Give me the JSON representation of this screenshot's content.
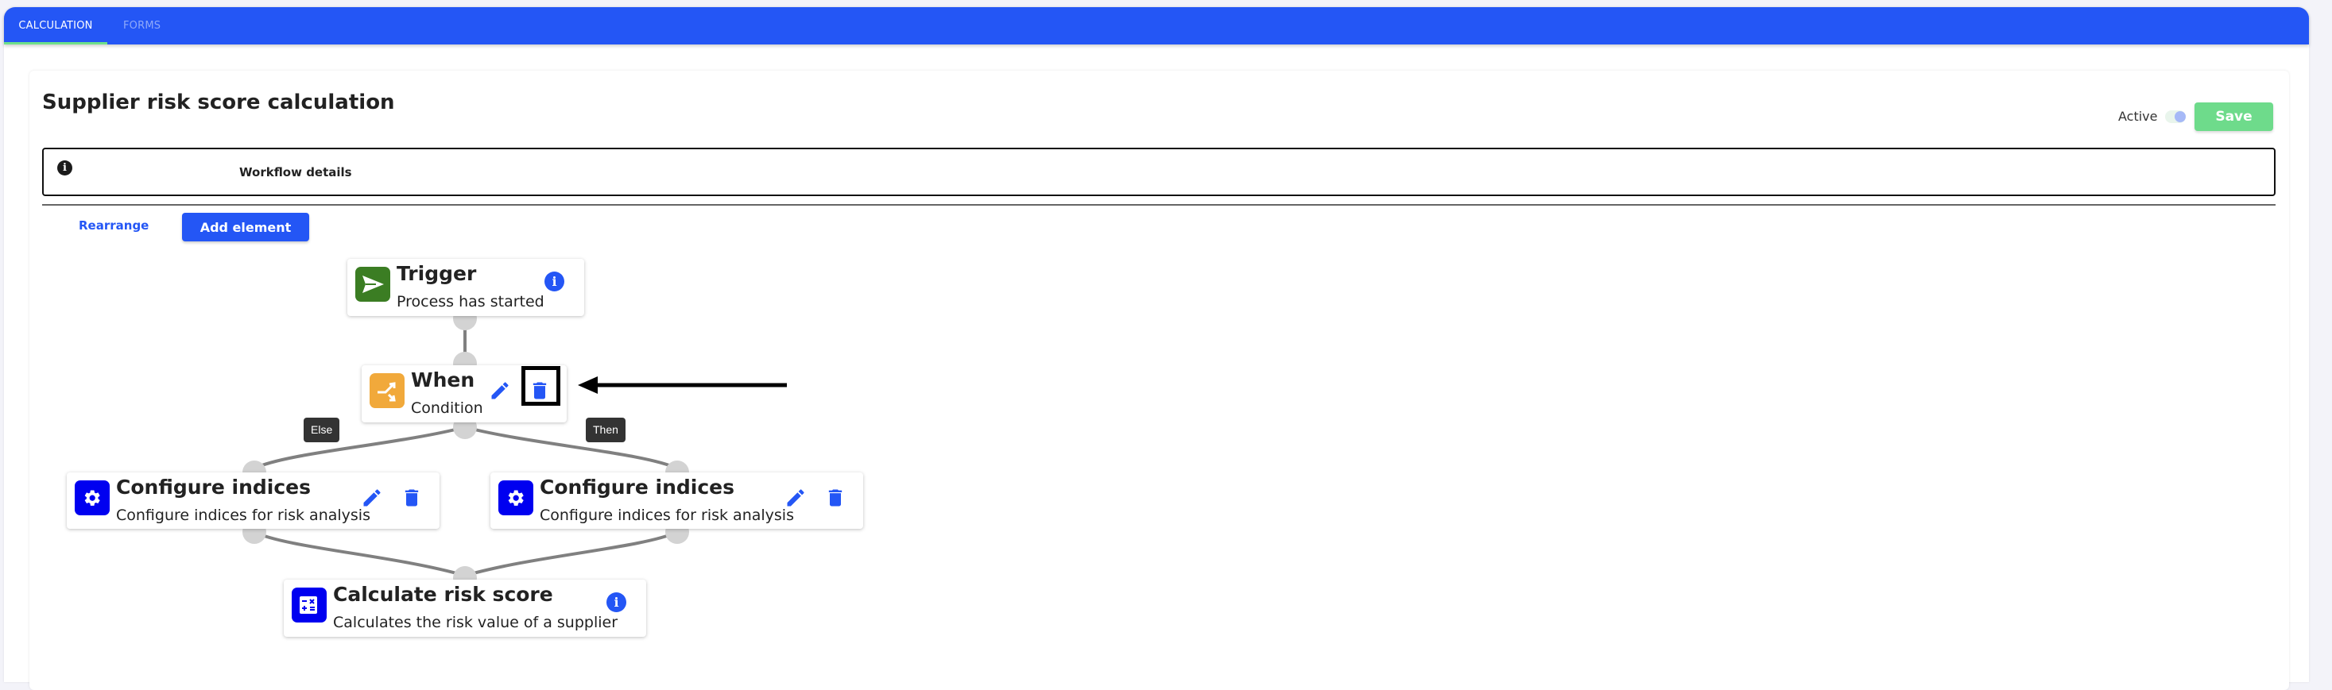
{
  "tabs": [
    {
      "label": "CALCULATION",
      "active": true
    },
    {
      "label": "FORMS",
      "active": false
    }
  ],
  "header": {
    "title": "Supplier risk score calculation",
    "active_label": "Active",
    "active_toggle_on": true,
    "save_label": "Save"
  },
  "workflow_details": {
    "icon": "info-icon",
    "label": "Workflow details"
  },
  "toolbar": {
    "rearrange_label": "Rearrange",
    "add_element_label": "Add element"
  },
  "colors": {
    "brand": "#2456f5",
    "save": "#6edb8b",
    "trigger": "#3b7d23",
    "condition": "#f1a93b",
    "action": "#0000f0",
    "edge": "#808080",
    "handle": "#d3d3d3"
  },
  "nodes": [
    {
      "id": "trigger",
      "title": "Trigger",
      "subtitle": "Process has started",
      "icon": "send-icon",
      "actions": [
        "info"
      ]
    },
    {
      "id": "when",
      "title": "When",
      "subtitle": "Condition",
      "icon": "split-icon",
      "actions": [
        "edit",
        "delete"
      ]
    },
    {
      "id": "configure-else",
      "title": "Configure indices",
      "subtitle": "Configure indices for risk analysis",
      "icon": "gear-icon",
      "actions": [
        "edit",
        "delete"
      ]
    },
    {
      "id": "configure-then",
      "title": "Configure indices",
      "subtitle": "Configure indices for risk analysis",
      "icon": "gear-icon",
      "actions": [
        "edit",
        "delete"
      ]
    },
    {
      "id": "calculate",
      "title": "Calculate risk score",
      "subtitle": "Calculates the risk value of a supplier",
      "icon": "calculator-icon",
      "actions": [
        "info"
      ]
    }
  ],
  "edges": [
    {
      "from": "trigger",
      "to": "when",
      "label": ""
    },
    {
      "from": "when",
      "to": "configure-else",
      "label": "Else"
    },
    {
      "from": "when",
      "to": "configure-then",
      "label": "Then"
    },
    {
      "from": "configure-else",
      "to": "calculate",
      "label": ""
    },
    {
      "from": "configure-then",
      "to": "calculate",
      "label": ""
    }
  ],
  "annotation": {
    "highlighted": "when-delete-button",
    "arrow": "pointing-left"
  }
}
